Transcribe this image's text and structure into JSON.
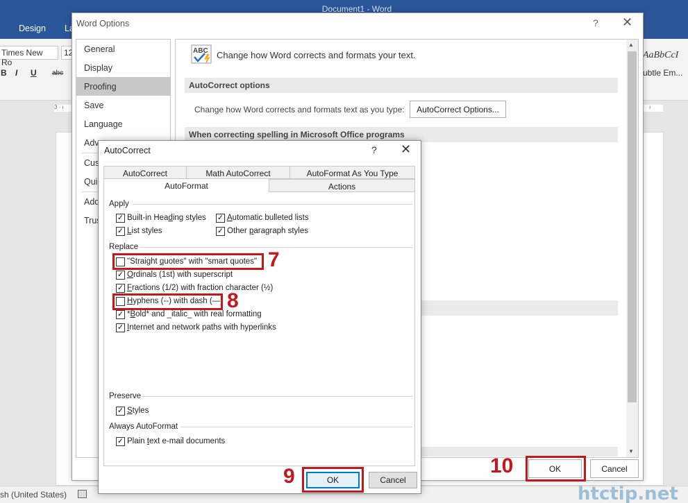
{
  "word": {
    "title": "Document1 - Word",
    "tabs": [
      "Design",
      "La"
    ],
    "font_name": "Times New Ro",
    "font_size": "12",
    "format_buttons": [
      "B",
      "I",
      "U",
      "abc"
    ],
    "styles": [
      "AaBbCcI",
      "ubtle Em..."
    ],
    "ruler_left": "3 · ı",
    "ruler_right": "ı",
    "status_language": "sh (United States)",
    "watermark": "htctip.net"
  },
  "word_options": {
    "title": "Word Options",
    "help": "?",
    "close": "✕",
    "nav": [
      "General",
      "Display",
      "Proofing",
      "Save",
      "Language",
      "Adv",
      "Cus",
      "Qui",
      "Add",
      "Trus"
    ],
    "heading": "Change how Word corrects and formats your text.",
    "section_autocorrect": "AutoCorrect options",
    "ac_label": "Change how Word corrects and formats text as you type:",
    "ac_button": "AutoCorrect Options...",
    "section_spelling": "When correcting spelling in Microsoft Office programs",
    "ok": "OK",
    "cancel": "Cancel"
  },
  "autocorrect": {
    "title": "AutoCorrect",
    "help": "?",
    "close": "✕",
    "tabs_back": [
      "AutoCorrect",
      "Math AutoCorrect",
      "AutoFormat As You Type"
    ],
    "tabs_front": [
      "AutoFormat",
      "Actions"
    ],
    "apply_label": "Apply",
    "apply": [
      {
        "pre": "Built-in Hea",
        "u": "d",
        "post": "ing styles",
        "checked": true
      },
      {
        "pre": "",
        "u": "A",
        "post": "utomatic bulleted lists",
        "checked": true
      },
      {
        "pre": "",
        "u": "L",
        "post": "ist styles",
        "checked": true
      },
      {
        "pre": "Other ",
        "u": "p",
        "post": "aragraph styles",
        "checked": true
      }
    ],
    "replace_label": "Replace",
    "replace": [
      {
        "pre": "\"Straight ",
        "u": "q",
        "post": "uotes\" with \"smart quotes\"",
        "checked": false
      },
      {
        "pre": "",
        "u": "O",
        "post": "rdinals (1st) with superscript",
        "checked": true
      },
      {
        "pre": "",
        "u": "F",
        "post": "ractions (1/2) with fraction character (½)",
        "checked": true
      },
      {
        "pre": "",
        "u": "H",
        "post": "yphens (--) with dash (—)",
        "checked": false
      },
      {
        "pre": "*",
        "u": "B",
        "post": "old* and _italic_ with real formatting",
        "checked": true
      },
      {
        "pre": "",
        "u": "I",
        "post": "nternet and network paths with hyperlinks",
        "checked": true
      }
    ],
    "preserve_label": "Preserve",
    "preserve": [
      {
        "pre": "",
        "u": "S",
        "post": "tyles",
        "checked": true
      }
    ],
    "always_label": "Always AutoFormat",
    "always": [
      {
        "pre": "Plain ",
        "u": "t",
        "post": "ext e-mail documents",
        "checked": true
      }
    ],
    "ok": "OK",
    "cancel": "Cancel",
    "check_mark": "✓"
  },
  "callouts": [
    "7",
    "8",
    "9",
    "10"
  ],
  "colors": {
    "word_blue": "#2b579a",
    "callout_red": "#c8161d",
    "selected_nav": "#c8c8c8",
    "focus_blue": "#0078d7"
  }
}
